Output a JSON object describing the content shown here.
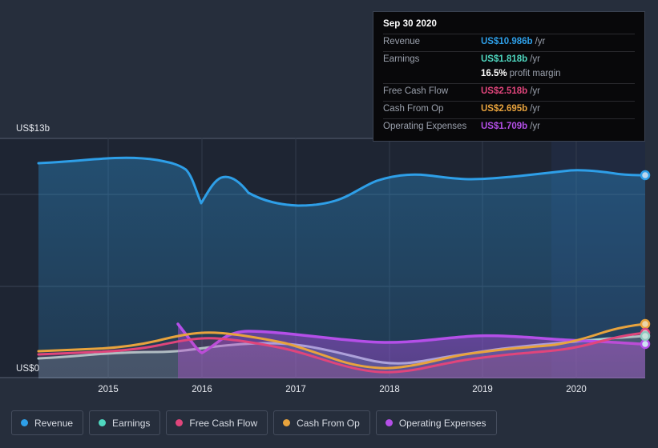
{
  "axes": {
    "y_top_label": "US$13b",
    "y_zero_label": "US$0",
    "x_ticks": [
      "2015",
      "2016",
      "2017",
      "2018",
      "2019",
      "2020"
    ]
  },
  "tooltip": {
    "title": "Sep 30 2020",
    "rows": [
      {
        "label": "Revenue",
        "value": "US$10.986b",
        "unit": "/yr",
        "color": "#2E9FE8"
      },
      {
        "label": "Earnings",
        "value": "US$1.818b",
        "unit": "/yr",
        "color": "#4FD8C0"
      },
      {
        "label": "",
        "value": "16.5%",
        "unit": "profit margin",
        "color": "#FFFFFF"
      },
      {
        "label": "Free Cash Flow",
        "value": "US$2.518b",
        "unit": "/yr",
        "color": "#E0457B"
      },
      {
        "label": "Cash From Op",
        "value": "US$2.695b",
        "unit": "/yr",
        "color": "#E8A33D"
      },
      {
        "label": "Operating Expenses",
        "value": "US$1.709b",
        "unit": "/yr",
        "color": "#B44FE8"
      }
    ]
  },
  "legend": [
    {
      "label": "Revenue",
      "color": "#2E9FE8"
    },
    {
      "label": "Earnings",
      "color": "#4FD8C0"
    },
    {
      "label": "Free Cash Flow",
      "color": "#E0457B"
    },
    {
      "label": "Cash From Op",
      "color": "#E8A33D"
    },
    {
      "label": "Operating Expenses",
      "color": "#B44FE8"
    }
  ],
  "chart_data": {
    "type": "area",
    "title": "",
    "xlabel": "",
    "ylabel": "US$",
    "ylim": [
      0,
      13
    ],
    "y_ticks": [
      0,
      13
    ],
    "y_unit": "US$ billions",
    "grid": "horizontal",
    "legend_position": "bottom",
    "x_tick_labels": [
      "2015",
      "2016",
      "2017",
      "2018",
      "2019",
      "2020"
    ],
    "x_range": [
      "2014-09",
      "2020-09"
    ],
    "highlight_value_date": "Sep 30 2020",
    "series": [
      {
        "name": "Revenue",
        "color": "#2E9FE8",
        "unit": "US$b/yr",
        "points": [
          {
            "x": "2014-09",
            "y": 11.6
          },
          {
            "x": "2014-12",
            "y": 11.62
          },
          {
            "x": "2015-03",
            "y": 11.7
          },
          {
            "x": "2015-06",
            "y": 11.85
          },
          {
            "x": "2015-09",
            "y": 11.92
          },
          {
            "x": "2015-12",
            "y": 11.9
          },
          {
            "x": "2016-03",
            "y": 11.6
          },
          {
            "x": "2016-06",
            "y": 11.52
          },
          {
            "x": "2016-09",
            "y": 8.6
          },
          {
            "x": "2016-12",
            "y": 10.35
          },
          {
            "x": "2017-03",
            "y": 9.6
          },
          {
            "x": "2017-06",
            "y": 9.05
          },
          {
            "x": "2017-09",
            "y": 8.95
          },
          {
            "x": "2017-12",
            "y": 9.1
          },
          {
            "x": "2018-03",
            "y": 9.35
          },
          {
            "x": "2018-06",
            "y": 10.35
          },
          {
            "x": "2018-09",
            "y": 10.72
          },
          {
            "x": "2018-12",
            "y": 10.62
          },
          {
            "x": "2019-03",
            "y": 10.58
          },
          {
            "x": "2019-06",
            "y": 10.68
          },
          {
            "x": "2019-09",
            "y": 10.8
          },
          {
            "x": "2019-12",
            "y": 11.05
          },
          {
            "x": "2020-03",
            "y": 11.22
          },
          {
            "x": "2020-06",
            "y": 11.05
          },
          {
            "x": "2020-09",
            "y": 10.986
          }
        ]
      },
      {
        "name": "Earnings",
        "color": "#4FD8C0",
        "unit": "US$b/yr",
        "points": [
          {
            "x": "2014-09",
            "y": 1.05
          },
          {
            "x": "2015-03",
            "y": 1.18
          },
          {
            "x": "2015-09",
            "y": 1.22
          },
          {
            "x": "2016-03",
            "y": 1.3
          },
          {
            "x": "2016-09",
            "y": 1.42
          },
          {
            "x": "2017-03",
            "y": 1.48
          },
          {
            "x": "2017-09",
            "y": 1.28
          },
          {
            "x": "2018-03",
            "y": 0.95
          },
          {
            "x": "2018-09",
            "y": 0.98
          },
          {
            "x": "2019-03",
            "y": 1.28
          },
          {
            "x": "2019-09",
            "y": 1.45
          },
          {
            "x": "2020-03",
            "y": 1.62
          },
          {
            "x": "2020-09",
            "y": 1.818
          }
        ]
      },
      {
        "name": "Free Cash Flow",
        "color": "#E0457B",
        "unit": "US$b/yr",
        "points": [
          {
            "x": "2014-09",
            "y": 1.15
          },
          {
            "x": "2015-03",
            "y": 1.18
          },
          {
            "x": "2015-09",
            "y": 1.52
          },
          {
            "x": "2016-03",
            "y": 1.78
          },
          {
            "x": "2016-09",
            "y": 1.6
          },
          {
            "x": "2017-03",
            "y": 1.82
          },
          {
            "x": "2017-09",
            "y": 1.3
          },
          {
            "x": "2018-03",
            "y": 0.32
          },
          {
            "x": "2018-09",
            "y": 0.3
          },
          {
            "x": "2019-03",
            "y": 1.05
          },
          {
            "x": "2019-09",
            "y": 1.45
          },
          {
            "x": "2020-03",
            "y": 1.78
          },
          {
            "x": "2020-09",
            "y": 2.518
          }
        ]
      },
      {
        "name": "Cash From Op",
        "color": "#E8A33D",
        "unit": "US$b/yr",
        "points": [
          {
            "x": "2014-09",
            "y": 1.3
          },
          {
            "x": "2015-03",
            "y": 1.35
          },
          {
            "x": "2015-09",
            "y": 1.82
          },
          {
            "x": "2016-03",
            "y": 2.02
          },
          {
            "x": "2016-09",
            "y": 1.85
          },
          {
            "x": "2017-03",
            "y": 2.05
          },
          {
            "x": "2017-09",
            "y": 1.55
          },
          {
            "x": "2018-03",
            "y": 0.58
          },
          {
            "x": "2018-09",
            "y": 0.62
          },
          {
            "x": "2019-03",
            "y": 1.35
          },
          {
            "x": "2019-09",
            "y": 1.7
          },
          {
            "x": "2020-03",
            "y": 1.98
          },
          {
            "x": "2020-09",
            "y": 2.695
          }
        ]
      },
      {
        "name": "Operating Expenses",
        "color": "#B44FE8",
        "unit": "US$b/yr",
        "points": [
          {
            "x": "2015-09",
            "y": 2.85
          },
          {
            "x": "2016-03",
            "y": 1.72
          },
          {
            "x": "2016-09",
            "y": 1.55
          },
          {
            "x": "2017-03",
            "y": 2.28
          },
          {
            "x": "2017-09",
            "y": 2.15
          },
          {
            "x": "2018-03",
            "y": 2.05
          },
          {
            "x": "2018-09",
            "y": 2.02
          },
          {
            "x": "2019-03",
            "y": 1.78
          },
          {
            "x": "2019-09",
            "y": 1.82
          },
          {
            "x": "2020-03",
            "y": 1.72
          },
          {
            "x": "2020-09",
            "y": 1.709
          }
        ]
      }
    ]
  }
}
